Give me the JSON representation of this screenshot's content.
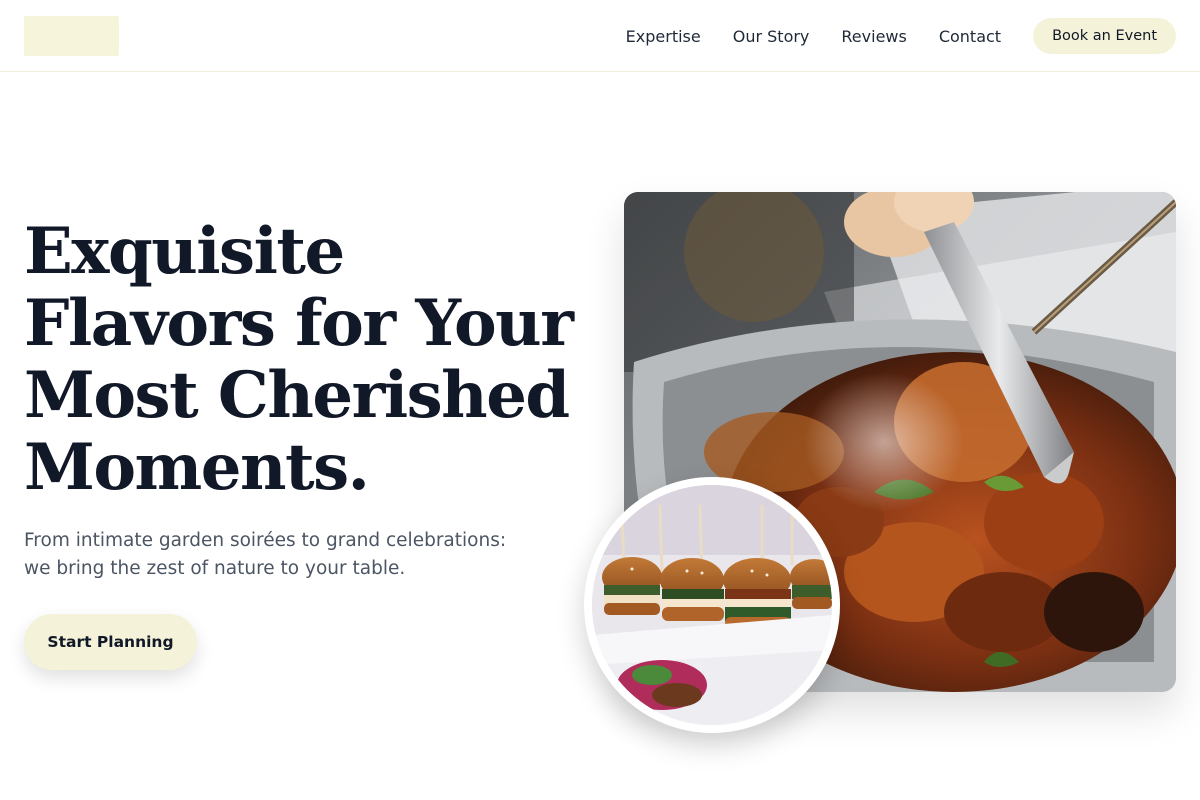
{
  "header": {
    "nav": [
      "Expertise",
      "Our Story",
      "Reviews",
      "Contact"
    ],
    "book_label": "Book an Event"
  },
  "hero": {
    "title_lines": [
      "Exquisite",
      "Flavors for Your",
      "Most Cherished",
      "Moments."
    ],
    "subtitle_lines": [
      "From intimate garden soirées to grand celebrations:",
      "we bring the zest of nature to your table."
    ],
    "cta_label": "Start Planning"
  },
  "images": {
    "main_photo": "grilled-chicken-with-tongs",
    "inset_photo": "slider-burgers-on-skewers"
  },
  "colors": {
    "accent": "#f4f3d9",
    "heading": "#111827",
    "body_text": "#4b5563"
  }
}
